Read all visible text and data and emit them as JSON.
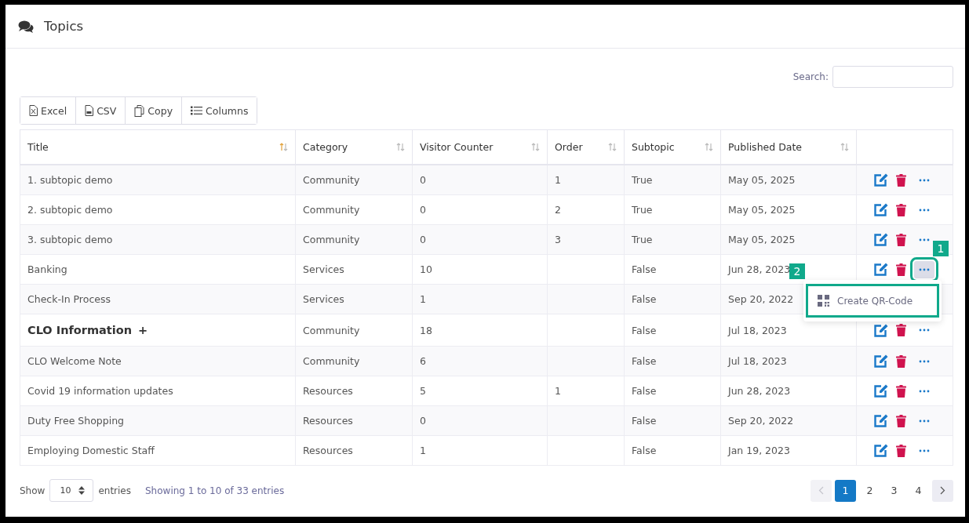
{
  "header": {
    "title": "Topics"
  },
  "search": {
    "label": "Search:"
  },
  "toolbar": [
    {
      "label": "Excel",
      "kind": "excel"
    },
    {
      "label": "CSV",
      "kind": "csv"
    },
    {
      "label": "Copy",
      "kind": "copy"
    },
    {
      "label": "Columns",
      "kind": "columns"
    }
  ],
  "table": {
    "columns": [
      {
        "label": "Title",
        "sorted": true
      },
      {
        "label": "Category",
        "sorted": false
      },
      {
        "label": "Visitor Counter",
        "sorted": false
      },
      {
        "label": "Order",
        "sorted": false
      },
      {
        "label": "Subtopic",
        "sorted": false
      },
      {
        "label": "Published Date",
        "sorted": false
      }
    ],
    "rows": [
      {
        "title": "1. subtopic demo",
        "category": "Community",
        "visitor_counter": "0",
        "order": "1",
        "subtopic": "True",
        "published_date": "May 05, 2025",
        "bold": false,
        "menu_open": false
      },
      {
        "title": "2. subtopic demo",
        "category": "Community",
        "visitor_counter": "0",
        "order": "2",
        "subtopic": "True",
        "published_date": "May 05, 2025",
        "bold": false,
        "menu_open": false
      },
      {
        "title": "3. subtopic demo",
        "category": "Community",
        "visitor_counter": "0",
        "order": "3",
        "subtopic": "True",
        "published_date": "May 05, 2025",
        "bold": false,
        "menu_open": false
      },
      {
        "title": "Banking",
        "category": "Services",
        "visitor_counter": "10",
        "subtopic": "False",
        "published_date": "Jun 28, 2023",
        "bold": false,
        "menu_open": true,
        "menu": [
          {
            "label": "Create QR-Code"
          }
        ]
      },
      {
        "title": "Check-In Process",
        "category": "Services",
        "visitor_counter": "1",
        "subtopic": "False",
        "published_date": "Sep 20, 2022",
        "bold": false,
        "menu_open": false
      },
      {
        "title": "CLO Information",
        "expander": "+",
        "category": "Community",
        "visitor_counter": "18",
        "subtopic": "False",
        "published_date": "Jul 18, 2023",
        "bold": true,
        "menu_open": false
      },
      {
        "title": "CLO Welcome Note",
        "category": "Community",
        "visitor_counter": "6",
        "subtopic": "False",
        "published_date": "Jul 18, 2023",
        "bold": false,
        "menu_open": false
      },
      {
        "title": "Covid 19 information updates",
        "category": "Resources",
        "visitor_counter": "5",
        "order": "1",
        "subtopic": "False",
        "published_date": "Jun 28, 2023",
        "bold": false,
        "menu_open": false
      },
      {
        "title": "Duty Free Shopping",
        "category": "Resources",
        "visitor_counter": "0",
        "subtopic": "False",
        "published_date": "Sep 20, 2022",
        "bold": false,
        "menu_open": false
      },
      {
        "title": "Employing Domestic Staff",
        "category": "Resources",
        "visitor_counter": "1",
        "subtopic": "False",
        "published_date": "Jan 19, 2023",
        "bold": false,
        "menu_open": false
      }
    ]
  },
  "footer": {
    "show_label": "Show",
    "page_size": "10",
    "entries_label": "entries",
    "info": "Showing 1 to 10 of 33 entries"
  },
  "pagination": {
    "previous_disabled": true,
    "pages": [
      {
        "label": "1",
        "selected": true
      },
      {
        "label": "2",
        "selected": false
      },
      {
        "label": "3",
        "selected": false
      },
      {
        "label": "4",
        "selected": false
      }
    ]
  },
  "callouts": [
    {
      "label": "1"
    },
    {
      "label": "2"
    }
  ]
}
